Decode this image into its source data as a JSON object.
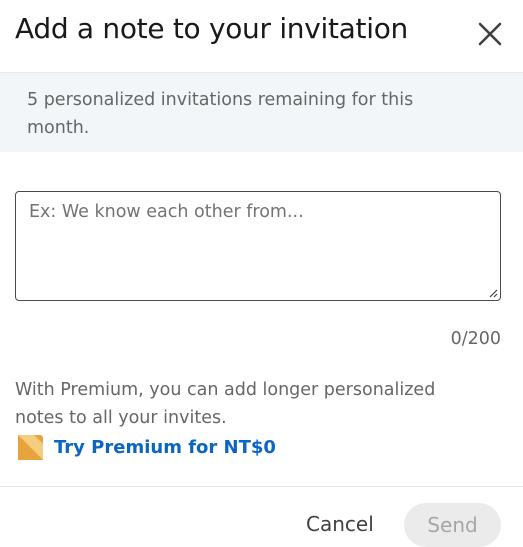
{
  "dialog": {
    "title": "Add a note to your invitation",
    "close_icon": "close-icon"
  },
  "notice": {
    "text": "5 personalized invitations remaining for this month."
  },
  "note": {
    "value": "",
    "placeholder": "Ex: We know each other from...",
    "counter": "0/200"
  },
  "premium": {
    "text": "With Premium, you can add longer personalized notes to all your invites.",
    "icon": "premium-icon",
    "link_label": "Try Premium for NT$0",
    "icon_colors": [
      "#e7a33e",
      "#f5cd7e"
    ],
    "link_color": "#0a66c2"
  },
  "footer": {
    "cancel_label": "Cancel",
    "send_label": "Send"
  }
}
